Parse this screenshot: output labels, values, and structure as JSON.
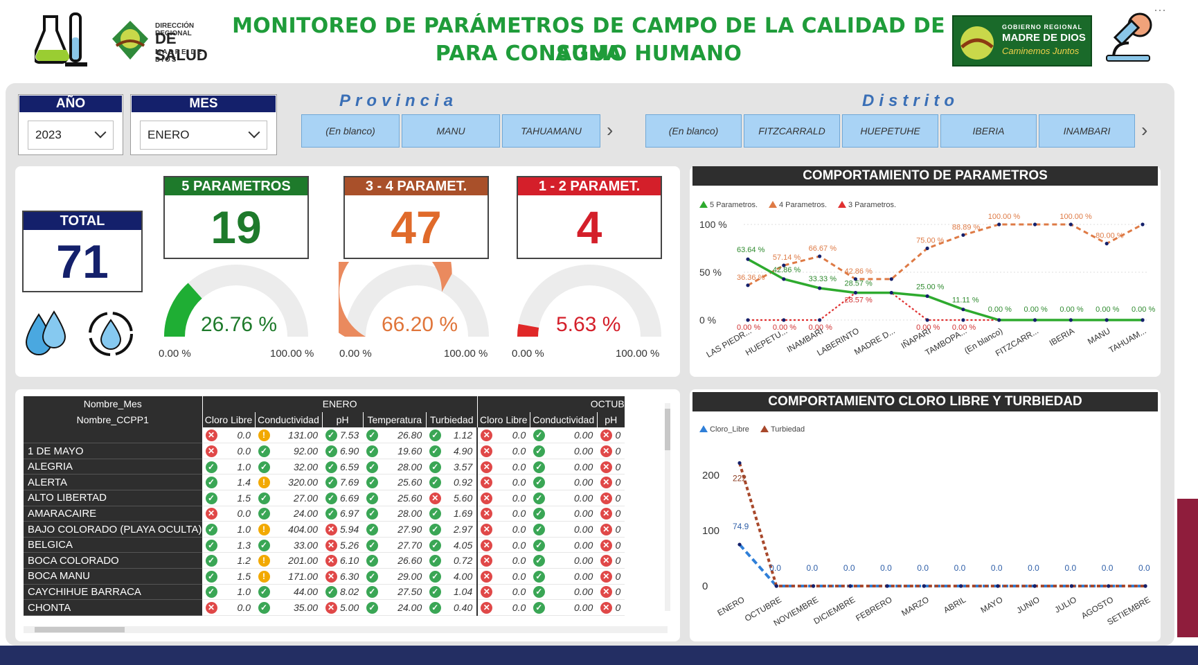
{
  "header": {
    "title_line1": "MONITOREO DE PARÁMETROS DE CAMPO DE LA CALIDAD DE AGUA",
    "title_line2": "PARA CONSUMO HUMANO",
    "logo_left": {
      "line1": "DIRECCIÓN REGIONAL",
      "line2": "DE SALUD",
      "line3": "MADRE DE DIOS"
    },
    "logo_right": {
      "line1": "GOBIERNO REGIONAL",
      "line2": "MADRE DE DIOS",
      "line3": "Caminemos Juntos"
    },
    "more_label": "···"
  },
  "filters": {
    "anio": {
      "label": "AÑO",
      "value": "2023"
    },
    "mes": {
      "label": "MES",
      "value": "ENERO"
    },
    "provincia": {
      "label": "Provincia",
      "tiles": [
        "(En blanco)",
        "MANU",
        "TAHUAMANU"
      ]
    },
    "distrito": {
      "label": "Distrito",
      "tiles": [
        "(En blanco)",
        "FITZCARRALD",
        "HUEPETUHE",
        "IBERIA",
        "INAMBARI"
      ]
    }
  },
  "kpis": {
    "total": {
      "label": "TOTAL",
      "value": "71"
    },
    "five": {
      "label": "5 PARAMETROS",
      "value": "19",
      "pct_label": "26.76 %",
      "pct": 26.76,
      "min": "0.00 %",
      "max": "100.00 %",
      "color": "#1fae34",
      "head_color": "#1e7a2b"
    },
    "three_four": {
      "label": "3 - 4 PARAMET.",
      "value": "47",
      "pct_label": "66.20 %",
      "pct": 66.2,
      "min": "0.00 %",
      "max": "100.00 %",
      "color": "#ea8a5e",
      "head_color": "#a9502a"
    },
    "one_two": {
      "label": "1 - 2 PARAMET.",
      "value": "4",
      "pct_label": "5.63 %",
      "pct": 5.63,
      "min": "0.00 %",
      "max": "100.00 %",
      "color": "#e02828",
      "head_color": "#d41f2a"
    }
  },
  "chart_data": [
    {
      "type": "line",
      "title": "COMPORTAMIENTO DE PARAMETROS",
      "categories": [
        "LAS PIEDR...",
        "HUEPETU...",
        "INAMBARI",
        "LABERINTO",
        "MADRE D...",
        "IÑAPARI",
        "TAMBOPA...",
        "(En blanco)",
        "FITZCARR...",
        "IBERIA",
        "MANU",
        "TAHUAM..."
      ],
      "series": [
        {
          "name": "5 Parametros.",
          "color": "#2eaa2e",
          "values": [
            63.64,
            42.86,
            33.33,
            28.57,
            28.57,
            25.0,
            11.11,
            0,
            0,
            0,
            0,
            0
          ]
        },
        {
          "name": "4 Parametros.",
          "color": "#de7a45",
          "values": [
            36.36,
            57.14,
            66.67,
            42.86,
            42.86,
            75.0,
            88.89,
            100,
            100,
            100,
            80.0,
            100
          ]
        },
        {
          "name": "3 Parametros.",
          "color": "#e03030",
          "values": [
            0,
            0,
            0,
            28.57,
            28.57,
            0,
            0,
            0,
            0,
            0,
            0,
            0
          ]
        }
      ],
      "y_ticks": [
        "100 %",
        "50 %",
        "0 %"
      ],
      "ylim": [
        0,
        100
      ],
      "labels_5": [
        "63.64 %",
        "42.86 %",
        "33.33 %",
        "28.57 %",
        "",
        "25.00 %",
        "11.11 %",
        "0.00 %",
        "0.00 %",
        "0.00 %",
        "0.00 %",
        "0.00 %"
      ],
      "labels_4": [
        "36.36 %",
        "57.14 %",
        "66.67 %",
        "42.86 %",
        "",
        "75.00 %",
        "88.89 %",
        "100.00 %",
        "",
        "100.00 %",
        "80.00 %",
        ""
      ],
      "labels_3": [
        "0.00 %",
        "0.00 %",
        "0.00 %",
        "28.57 %",
        "",
        "0.00 %",
        "0.00 %",
        "",
        "",
        "",
        "",
        ""
      ]
    },
    {
      "type": "line",
      "title": "COMPORTAMIENTO CLORO LIBRE Y TURBIEDAD",
      "categories": [
        "ENERO",
        "OCTUBRE",
        "NOVIEMBRE",
        "DICIEMBRE",
        "FEBRERO",
        "MARZO",
        "ABRIL",
        "MAYO",
        "JUNIO",
        "JULIO",
        "AGOSTO",
        "SETIEMBRE"
      ],
      "series": [
        {
          "name": "Cloro_Libre",
          "color": "#2f7fd8",
          "values": [
            74.9,
            0,
            0,
            0,
            0,
            0,
            0,
            0,
            0,
            0,
            0,
            0
          ]
        },
        {
          "name": "Turbiedad",
          "color": "#a8482b",
          "values": [
            222,
            0,
            0,
            0,
            0,
            0,
            0,
            0,
            0,
            0,
            0,
            0
          ]
        }
      ],
      "y_ticks": [
        "200",
        "100",
        "0"
      ],
      "ylim": [
        0,
        250
      ],
      "labels_cloro": [
        "74.9",
        "0.0",
        "0.0",
        "0.0",
        "0.0",
        "0.0",
        "0.0",
        "0.0",
        "0.0",
        "0.0",
        "0.0",
        "0.0"
      ],
      "labels_turb": [
        "222",
        "",
        "",
        "",
        "",
        "",
        "",
        "",
        "",
        "",
        "",
        ""
      ]
    }
  ],
  "table": {
    "row_header_1": "Nombre_Mes",
    "row_header_2": "Nombre_CCPP1",
    "month_1": "ENERO",
    "month_2": "OCTUB",
    "columns": [
      "Cloro Libre",
      "Conductividad",
      "pH",
      "Temperatura",
      "Turbiedad",
      "Cloro Libre",
      "Conductividad",
      "pH"
    ],
    "rows": [
      {
        "name": "",
        "cells": [
          [
            "bad",
            "0.0"
          ],
          [
            "warn",
            "131.00"
          ],
          [
            "ok",
            "7.53"
          ],
          [
            "ok",
            "26.80"
          ],
          [
            "ok",
            "1.12"
          ],
          [
            "bad",
            "0.0"
          ],
          [
            "ok",
            "0.00"
          ],
          [
            "bad",
            "0"
          ]
        ]
      },
      {
        "name": "1 DE MAYO",
        "cells": [
          [
            "bad",
            "0.0"
          ],
          [
            "ok",
            "92.00"
          ],
          [
            "ok",
            "6.90"
          ],
          [
            "ok",
            "19.60"
          ],
          [
            "ok",
            "4.90"
          ],
          [
            "bad",
            "0.0"
          ],
          [
            "ok",
            "0.00"
          ],
          [
            "bad",
            "0"
          ]
        ]
      },
      {
        "name": "ALEGRIA",
        "cells": [
          [
            "ok",
            "1.0"
          ],
          [
            "ok",
            "32.00"
          ],
          [
            "ok",
            "6.59"
          ],
          [
            "ok",
            "28.00"
          ],
          [
            "ok",
            "3.57"
          ],
          [
            "bad",
            "0.0"
          ],
          [
            "ok",
            "0.00"
          ],
          [
            "bad",
            "0"
          ]
        ]
      },
      {
        "name": "ALERTA",
        "cells": [
          [
            "ok",
            "1.4"
          ],
          [
            "warn",
            "320.00"
          ],
          [
            "ok",
            "7.69"
          ],
          [
            "ok",
            "25.60"
          ],
          [
            "ok",
            "0.92"
          ],
          [
            "bad",
            "0.0"
          ],
          [
            "ok",
            "0.00"
          ],
          [
            "bad",
            "0"
          ]
        ]
      },
      {
        "name": "ALTO LIBERTAD",
        "cells": [
          [
            "ok",
            "1.5"
          ],
          [
            "ok",
            "27.00"
          ],
          [
            "ok",
            "6.69"
          ],
          [
            "ok",
            "25.60"
          ],
          [
            "bad",
            "5.60"
          ],
          [
            "bad",
            "0.0"
          ],
          [
            "ok",
            "0.00"
          ],
          [
            "bad",
            "0"
          ]
        ]
      },
      {
        "name": "AMARACAIRE",
        "cells": [
          [
            "bad",
            "0.0"
          ],
          [
            "ok",
            "24.00"
          ],
          [
            "ok",
            "6.97"
          ],
          [
            "ok",
            "28.00"
          ],
          [
            "ok",
            "1.69"
          ],
          [
            "bad",
            "0.0"
          ],
          [
            "ok",
            "0.00"
          ],
          [
            "bad",
            "0"
          ]
        ]
      },
      {
        "name": "BAJO COLORADO (PLAYA OCULTA)",
        "cells": [
          [
            "ok",
            "1.0"
          ],
          [
            "warn",
            "404.00"
          ],
          [
            "bad",
            "5.94"
          ],
          [
            "ok",
            "27.90"
          ],
          [
            "ok",
            "2.97"
          ],
          [
            "bad",
            "0.0"
          ],
          [
            "ok",
            "0.00"
          ],
          [
            "bad",
            "0"
          ]
        ]
      },
      {
        "name": "BELGICA",
        "cells": [
          [
            "ok",
            "1.3"
          ],
          [
            "ok",
            "33.00"
          ],
          [
            "bad",
            "5.26"
          ],
          [
            "ok",
            "27.70"
          ],
          [
            "ok",
            "4.05"
          ],
          [
            "bad",
            "0.0"
          ],
          [
            "ok",
            "0.00"
          ],
          [
            "bad",
            "0"
          ]
        ]
      },
      {
        "name": "BOCA COLORADO",
        "cells": [
          [
            "ok",
            "1.2"
          ],
          [
            "warn",
            "201.00"
          ],
          [
            "bad",
            "6.10"
          ],
          [
            "ok",
            "26.60"
          ],
          [
            "ok",
            "0.72"
          ],
          [
            "bad",
            "0.0"
          ],
          [
            "ok",
            "0.00"
          ],
          [
            "bad",
            "0"
          ]
        ]
      },
      {
        "name": "BOCA MANU",
        "cells": [
          [
            "ok",
            "1.5"
          ],
          [
            "warn",
            "171.00"
          ],
          [
            "bad",
            "6.30"
          ],
          [
            "ok",
            "29.00"
          ],
          [
            "ok",
            "4.00"
          ],
          [
            "bad",
            "0.0"
          ],
          [
            "ok",
            "0.00"
          ],
          [
            "bad",
            "0"
          ]
        ]
      },
      {
        "name": "CAYCHIHUE BARRACA",
        "cells": [
          [
            "ok",
            "1.0"
          ],
          [
            "ok",
            "44.00"
          ],
          [
            "ok",
            "8.02"
          ],
          [
            "ok",
            "27.50"
          ],
          [
            "ok",
            "1.04"
          ],
          [
            "bad",
            "0.0"
          ],
          [
            "ok",
            "0.00"
          ],
          [
            "bad",
            "0"
          ]
        ]
      },
      {
        "name": "CHONTA",
        "cells": [
          [
            "bad",
            "0.0"
          ],
          [
            "ok",
            "35.00"
          ],
          [
            "bad",
            "5.00"
          ],
          [
            "ok",
            "24.00"
          ],
          [
            "ok",
            "0.40"
          ],
          [
            "bad",
            "0.0"
          ],
          [
            "ok",
            "0.00"
          ],
          [
            "bad",
            "0"
          ]
        ]
      }
    ]
  }
}
